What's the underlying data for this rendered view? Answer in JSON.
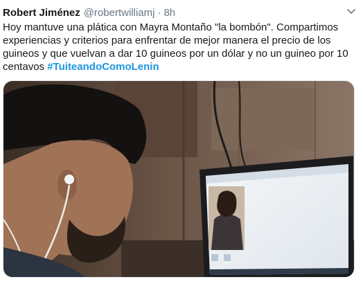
{
  "tweet": {
    "author_name": "Robert Jiménez",
    "handle": "@robertwilliamj",
    "separator": "·",
    "time": "8h",
    "text": "Hoy mantuve una plática con Mayra Montaño \"la bombón\". Compartimos experiencias y criterios para enfrentar de mejor manera el precio de los guineos y que vuelvan a dar 10 guineos por un dólar y no un guineo por 10 centavos ",
    "hashtag": "#TuiteandoComoLenin"
  },
  "icons": {
    "menu": "chevron-down-icon"
  },
  "colors": {
    "link": "#1b95e0",
    "muted": "#657786",
    "text": "#14171a"
  }
}
